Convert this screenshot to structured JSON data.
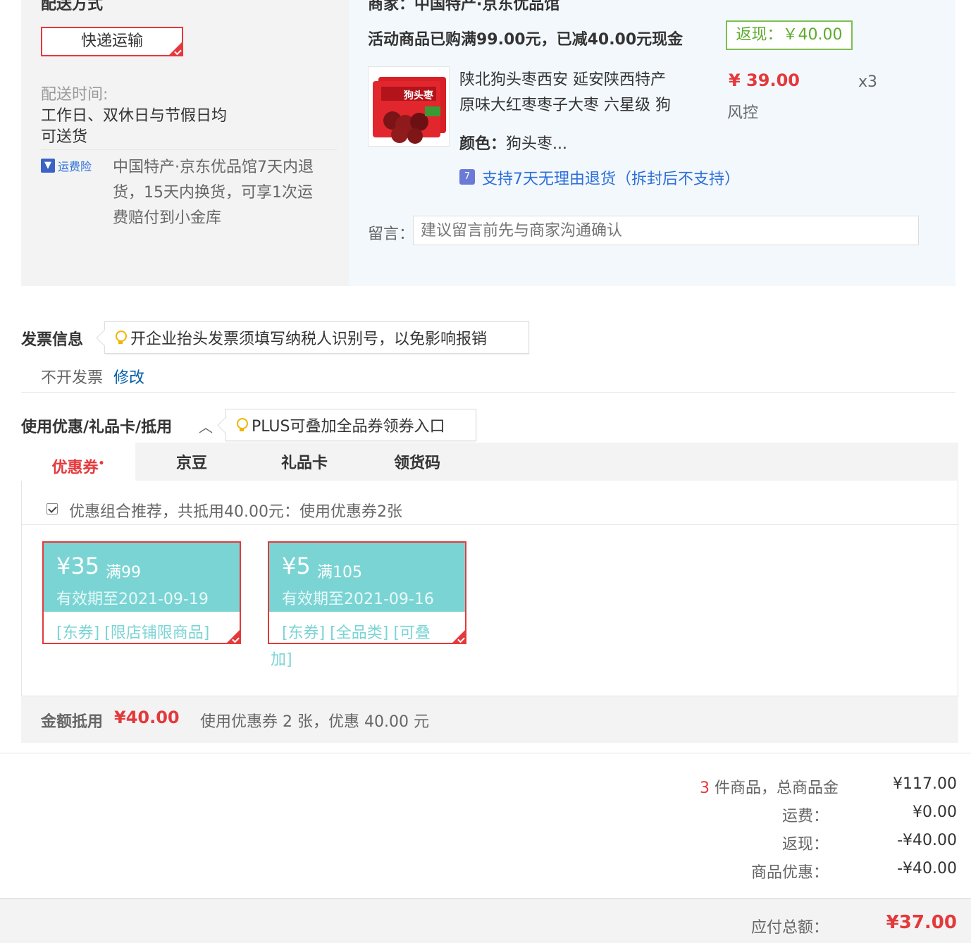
{
  "shipping": {
    "section_title": "配送方式",
    "method_label": "快递运输",
    "time_label": "配送时间:",
    "time_value_line1": "工作日、双休日与节假日均",
    "time_value_line2": "可送货",
    "insurance_badge": "运费险",
    "insurance_line1": "中国特产·京东优品馆7天内退",
    "insurance_line2": "货，15天内换货，可享1次运",
    "insurance_line3": "费赔付到小金库"
  },
  "store": {
    "merchant_line": "商家：中国特产·京东优品馆",
    "promo_text": "活动商品已购满99.00元，已减40.00元现金",
    "cashback_badge": "返现：￥40.00",
    "product": {
      "image_text": "狗头枣",
      "title_line1": "陕北狗头枣西安 延安陕西特产",
      "title_line2": "原味大红枣枣子大枣 六星级 狗",
      "color_label": "颜色：",
      "color_value": "狗头枣...",
      "price": "¥ 39.00",
      "risk_label": "风控",
      "quantity": "x3",
      "return_icon": "7",
      "return_policy": "支持7天无理由退货（拆封后不支持）"
    },
    "memo_label": "留言：",
    "memo_placeholder": "建议留言前先与商家沟通确认"
  },
  "invoice": {
    "title": "发票信息",
    "tip": "开企业抬头发票须填写纳税人识别号，以免影响报销",
    "status": "不开发票",
    "edit_link": "修改"
  },
  "discount": {
    "title": "使用优惠/礼品卡/抵用",
    "tip": "PLUS可叠加全品券领券入口",
    "tabs": [
      "优惠券",
      "京豆",
      "礼品卡",
      "领货码"
    ],
    "active_tab_mark": "•",
    "recommend_text": "优惠组合推荐，共抵用40.00元：使用优惠券2张",
    "coupons": [
      {
        "amount": "¥35",
        "condition": "满99",
        "expiry": "有效期至2021-09-19",
        "tags": "[东券] [限店铺限商品]",
        "tags_wrap": ""
      },
      {
        "amount": "¥5",
        "condition": "满105",
        "expiry": "有效期至2021-09-16",
        "tags": "[东券] [全品类] [可叠",
        "tags_wrap": "加]"
      }
    ],
    "summary_label": "金额抵用",
    "summary_amount": "¥40.00",
    "summary_text": "使用优惠券 2 张，优惠 40.00 元"
  },
  "totals": {
    "item_count": "3",
    "items_label": "件商品，总商品金",
    "items_amount": "¥117.00",
    "shipping_label": "运费：",
    "shipping_amount": "¥0.00",
    "cashback_label": "返现：",
    "cashback_amount": "-¥40.00",
    "discount_label": "商品优惠：",
    "discount_amount": "-¥40.00",
    "payable_label": "应付总额：",
    "payable_amount": "¥37.00"
  },
  "colors": {
    "accent_red": "#e4393c",
    "link_blue": "#005ea7",
    "coupon_teal": "#7bd4d4",
    "cashback_green": "#5cab2d"
  }
}
